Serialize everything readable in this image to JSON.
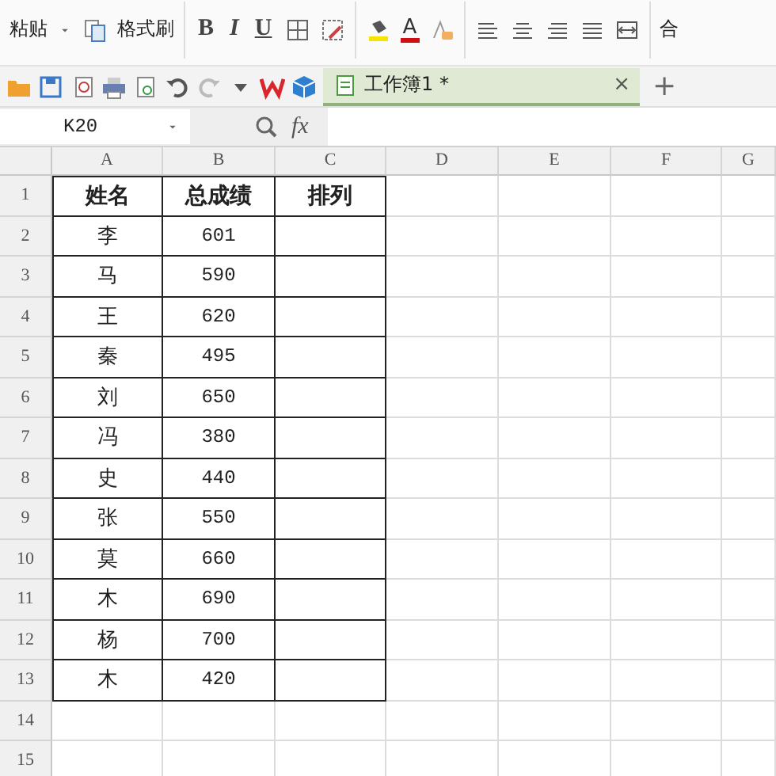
{
  "ribbon": {
    "paste_label": "粘贴",
    "format_painter_label": "格式刷",
    "bold": "B",
    "italic": "I",
    "underline": "U",
    "font_color_letter": "A",
    "merge_label": "合"
  },
  "quick_access": {
    "document_tab": {
      "title": "工作簿1 *",
      "close": "×",
      "selected": true
    },
    "new_tab": "+"
  },
  "formula_bar": {
    "cell_reference": "K20",
    "fx": "fx"
  },
  "sheet": {
    "columns": [
      "A",
      "B",
      "C",
      "D",
      "E",
      "F",
      "G"
    ],
    "rows": [
      {
        "number": "1",
        "kind": "header",
        "cells": [
          "姓名",
          "总成绩",
          "排列"
        ]
      },
      {
        "number": "2",
        "kind": "data",
        "cells": [
          "李",
          "601"
        ]
      },
      {
        "number": "3",
        "kind": "data",
        "cells": [
          "马",
          "590"
        ]
      },
      {
        "number": "4",
        "kind": "data",
        "cells": [
          "王",
          "620"
        ]
      },
      {
        "number": "5",
        "kind": "data",
        "cells": [
          "秦",
          "495"
        ]
      },
      {
        "number": "6",
        "kind": "data",
        "cells": [
          "刘",
          "650"
        ]
      },
      {
        "number": "7",
        "kind": "data",
        "cells": [
          "冯",
          "380"
        ]
      },
      {
        "number": "8",
        "kind": "data",
        "cells": [
          "史",
          "440"
        ]
      },
      {
        "number": "9",
        "kind": "data",
        "cells": [
          "张",
          "550"
        ]
      },
      {
        "number": "10",
        "kind": "data",
        "cells": [
          "莫",
          "660"
        ]
      },
      {
        "number": "11",
        "kind": "data",
        "cells": [
          "木",
          "690"
        ]
      },
      {
        "number": "12",
        "kind": "data",
        "cells": [
          "杨",
          "700"
        ]
      },
      {
        "number": "13",
        "kind": "data",
        "cells": [
          "木",
          "420"
        ]
      },
      {
        "number": "14",
        "kind": "blank"
      },
      {
        "number": "15",
        "kind": "blank"
      }
    ]
  }
}
